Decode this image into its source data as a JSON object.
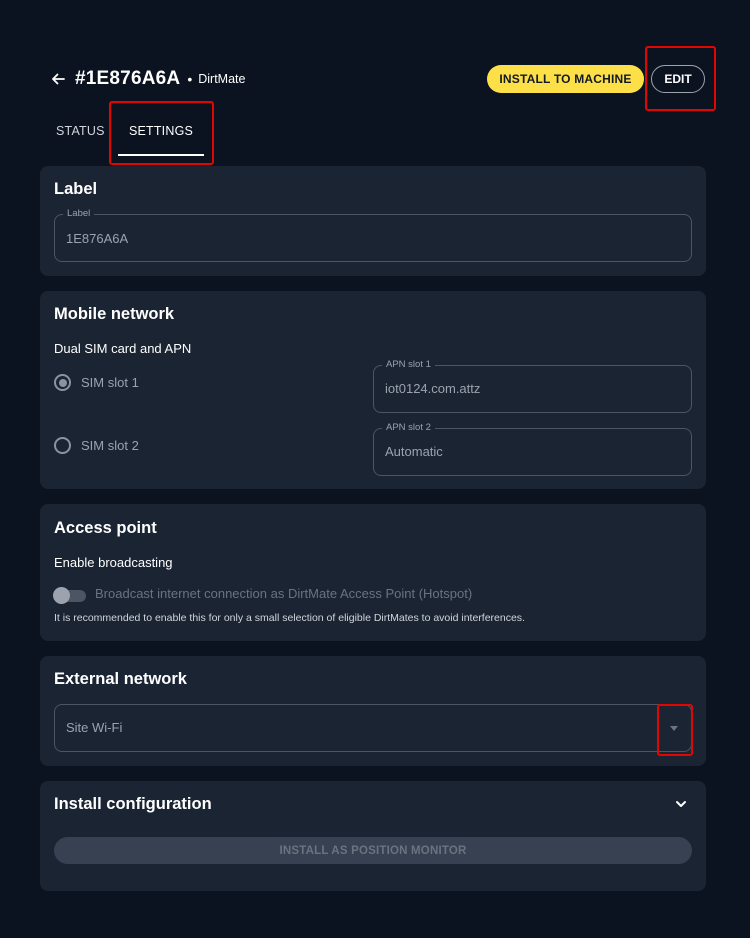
{
  "header": {
    "device_id": "#1E876A6A",
    "separator": "•",
    "device_type": "DirtMate",
    "install_button": "INSTALL TO MACHINE",
    "edit_button": "EDIT"
  },
  "tabs": [
    {
      "label": "STATUS",
      "active": false
    },
    {
      "label": "SETTINGS",
      "active": true
    }
  ],
  "label_section": {
    "title": "Label",
    "field_legend": "Label",
    "field_value": "1E876A6A"
  },
  "mobile_network": {
    "title": "Mobile network",
    "subtitle": "Dual SIM card and APN",
    "sim_slots": [
      {
        "label": "SIM slot 1",
        "selected": true,
        "apn_legend": "APN slot 1",
        "apn_value": "iot0124.com.attz"
      },
      {
        "label": "SIM slot 2",
        "selected": false,
        "apn_legend": "APN slot 2",
        "apn_value": "Automatic"
      }
    ]
  },
  "access_point": {
    "title": "Access point",
    "subtitle": "Enable broadcasting",
    "toggle_label": "Broadcast internet connection as DirtMate Access Point (Hotspot)",
    "toggle_on": false,
    "hint": "It is recommended to enable this for only a small selection of eligible DirtMates to avoid interferences."
  },
  "external_network": {
    "title": "External network",
    "selected_value": "Site Wi-Fi"
  },
  "install_config": {
    "title": "Install configuration",
    "button_label": "INSTALL AS POSITION MONITOR"
  },
  "icons": {
    "back": "arrow-left-icon",
    "dropdown": "caret-down-icon",
    "expand": "chevron-down-icon"
  },
  "colors": {
    "background": "#0b1220",
    "card": "#1b2433",
    "accent": "#fde047",
    "highlight": "#e10600"
  }
}
